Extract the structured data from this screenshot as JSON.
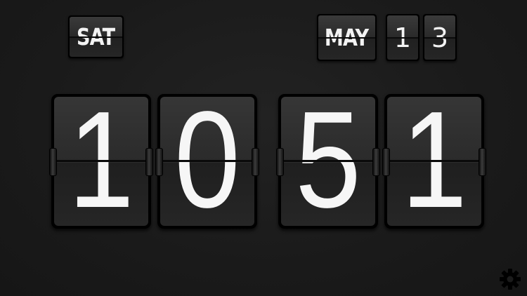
{
  "date": {
    "day": "SAT",
    "month": "MAY",
    "date_digits": [
      "1",
      "3"
    ]
  },
  "time": {
    "digits": [
      "1",
      "0",
      "5",
      "1"
    ]
  },
  "settings": {
    "icon": "gear-icon"
  },
  "colors": {
    "background": "#1b1b1b",
    "card": "#2b2b2b",
    "digit": "#f6f6f6"
  }
}
